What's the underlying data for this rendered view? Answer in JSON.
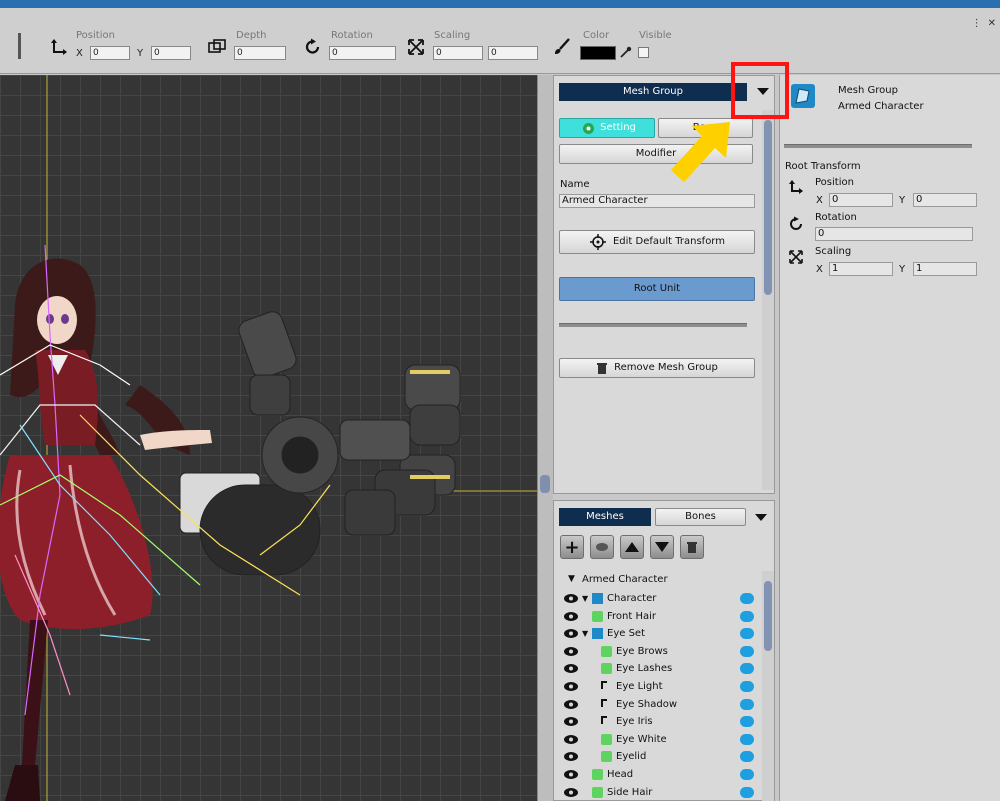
{
  "toolbar": {
    "position_label": "Position",
    "pos_x_axis": "X",
    "pos_x": "0",
    "pos_y_axis": "Y",
    "pos_y": "0",
    "depth_label": "Depth",
    "depth": "0",
    "rotation_label": "Rotation",
    "rotation": "0",
    "scaling_label": "Scaling",
    "scale_x": "0",
    "scale_y": "0",
    "color_label": "Color",
    "color_value": "#000000",
    "visible_label": "Visible"
  },
  "middle": {
    "header_select": "Mesh Group",
    "setting_tab": "Setting",
    "bone_tab": "Bone",
    "modifier_tab": "Modifier",
    "name_label": "Name",
    "name_value": "Armed Character",
    "edit_default_transform": "Edit Default Transform",
    "root_unit": "Root Unit",
    "remove_mesh_group": "Remove Mesh Group"
  },
  "meshes": {
    "tab_meshes": "Meshes",
    "tab_bones": "Bones",
    "root": "Armed Character",
    "items": [
      {
        "label": "Character",
        "kind": "group",
        "indent": 0
      },
      {
        "label": "Front Hair",
        "kind": "mesh",
        "indent": 0
      },
      {
        "label": "Eye Set",
        "kind": "group",
        "indent": 0
      },
      {
        "label": "Eye Brows",
        "kind": "mesh",
        "indent": 1
      },
      {
        "label": "Eye Lashes",
        "kind": "mesh",
        "indent": 1
      },
      {
        "label": "Eye Light",
        "kind": "bone",
        "indent": 1
      },
      {
        "label": "Eye Shadow",
        "kind": "bone",
        "indent": 1
      },
      {
        "label": "Eye Iris",
        "kind": "bone",
        "indent": 1
      },
      {
        "label": "Eye White",
        "kind": "mesh",
        "indent": 1
      },
      {
        "label": "Eyelid",
        "kind": "mesh",
        "indent": 1
      },
      {
        "label": "Head",
        "kind": "mesh",
        "indent": 0
      },
      {
        "label": "Side Hair",
        "kind": "mesh",
        "indent": 0
      }
    ]
  },
  "right": {
    "type_label": "Mesh Group",
    "object_name": "Armed Character",
    "root_transform": "Root Transform",
    "position_label": "Position",
    "pos_x_axis": "X",
    "pos_x": "0",
    "pos_y_axis": "Y",
    "pos_y": "0",
    "rotation_label": "Rotation",
    "rotation": "0",
    "scaling_label": "Scaling",
    "scale_x_axis": "X",
    "scale_x": "1",
    "scale_y_axis": "Y",
    "scale_y": "1"
  },
  "colors": {
    "accent_cyan": "#3fe0dc",
    "root_unit_blue": "#6b9acf",
    "header_navy": "#0f2d4e",
    "highlight_red": "#ff1414",
    "arrow_yellow": "#ffd000"
  }
}
